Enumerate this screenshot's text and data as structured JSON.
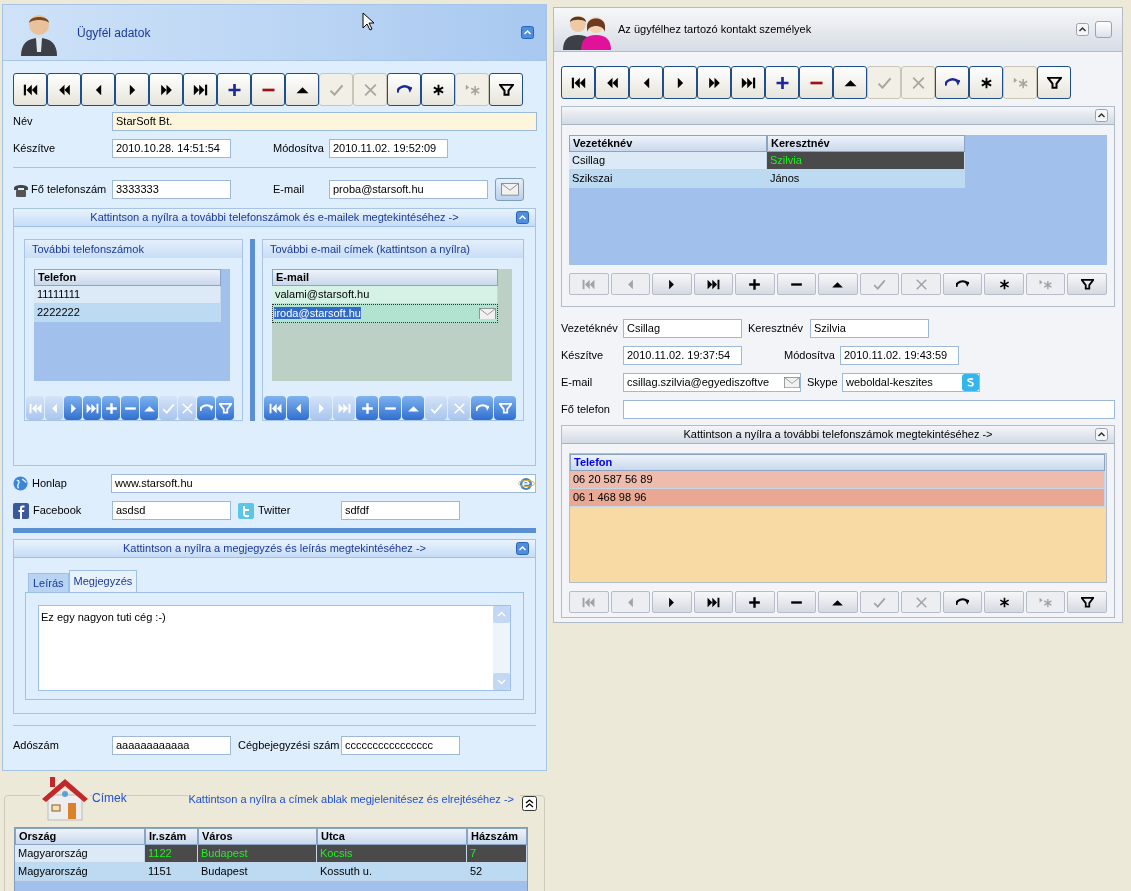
{
  "customer": {
    "title": "Ügyfél adatok",
    "toolbar": [
      {
        "kind": "first",
        "disabled": false
      },
      {
        "kind": "prior_page",
        "disabled": false
      },
      {
        "kind": "prior",
        "disabled": false
      },
      {
        "kind": "next",
        "disabled": false
      },
      {
        "kind": "next_page",
        "disabled": false
      },
      {
        "kind": "last",
        "disabled": false
      },
      {
        "kind": "insert",
        "disabled": false
      },
      {
        "kind": "delete",
        "disabled": false
      },
      {
        "kind": "edit",
        "disabled": false
      },
      {
        "kind": "post",
        "disabled": true
      },
      {
        "kind": "cancel",
        "disabled": true
      },
      {
        "kind": "refresh",
        "disabled": false
      },
      {
        "kind": "apply",
        "disabled": false
      },
      {
        "kind": "cancel_updates",
        "disabled": true
      },
      {
        "kind": "filter",
        "disabled": false
      }
    ],
    "name_label": "Név",
    "name": "StarSoft Bt.",
    "created_label": "Készítve",
    "created": "2010.10.28. 14:51:54",
    "modified_label": "Módosítva",
    "modified": "2010.11.02. 19:52:09",
    "phone_label": "Fő telefonszám",
    "phone": "3333333",
    "email_label": "E-mail",
    "email": "proba@starsoft.hu",
    "contact_section": {
      "title": "Kattintson a nyílra a további telefonszámok és e-mailek megtekintéséhez ->",
      "phones": {
        "title": "További telefonszámok",
        "columns": [
          "Telefon"
        ],
        "rows": [
          {
            "cells": [
              "11111111"
            ],
            "selected": false
          },
          {
            "cells": [
              "2222222"
            ],
            "selected": false
          }
        ],
        "toolbar": [
          {
            "kind": "first",
            "disabled": true
          },
          {
            "kind": "prior",
            "disabled": true
          },
          {
            "kind": "next",
            "disabled": false
          },
          {
            "kind": "last",
            "disabled": false
          },
          {
            "kind": "insert",
            "disabled": false
          },
          {
            "kind": "delete",
            "disabled": false
          },
          {
            "kind": "edit",
            "disabled": false
          },
          {
            "kind": "post",
            "disabled": true
          },
          {
            "kind": "cancel",
            "disabled": true
          },
          {
            "kind": "refresh",
            "disabled": false
          },
          {
            "kind": "filter",
            "disabled": false
          }
        ]
      },
      "emails": {
        "title": "További e-mail címek (kattintson a nyílra)",
        "columns": [
          "E-mail"
        ],
        "rows": [
          {
            "cells": [
              "valami@starsoft.hu"
            ],
            "selected": false
          },
          {
            "cells": [
              "iroda@starsoft.hu"
            ],
            "selected": true
          }
        ],
        "toolbar": [
          {
            "kind": "first",
            "disabled": false
          },
          {
            "kind": "prior",
            "disabled": false
          },
          {
            "kind": "next",
            "disabled": true
          },
          {
            "kind": "last",
            "disabled": true
          },
          {
            "kind": "insert",
            "disabled": false
          },
          {
            "kind": "delete",
            "disabled": false
          },
          {
            "kind": "edit",
            "disabled": false
          },
          {
            "kind": "post",
            "disabled": true
          },
          {
            "kind": "cancel",
            "disabled": true
          },
          {
            "kind": "refresh",
            "disabled": false
          },
          {
            "kind": "filter",
            "disabled": false
          }
        ]
      }
    },
    "homepage_label": "Honlap",
    "homepage": "www.starsoft.hu",
    "facebook_label": "Facebook",
    "facebook": "asdsd",
    "twitter_label": "Twitter",
    "twitter": "sdfdf",
    "notes_section": {
      "title": "Kattintson a nyílra a megjegyzés és leírás megtekintéséhez ->",
      "tabs": [
        {
          "label": "Leírás",
          "selected": false
        },
        {
          "label": "Megjegyzés",
          "selected": true
        }
      ],
      "text": "Ez egy nagyon tuti cég :-)"
    },
    "tax_label": "Adószám",
    "tax": "aaaaaaaaaaaa",
    "registry_label": "Cégbejegyzési szám",
    "registry": "cccccccccccccccc"
  },
  "addresses": {
    "title": "Címek",
    "hint": "Kattintson a nyílra a címek ablak megjelenitésez és elrejtéséhez ->",
    "columns": [
      "Ország",
      "Ir.szám",
      "Város",
      "Utca",
      "Házszám"
    ],
    "rows": [
      {
        "cells": [
          "Magyarország",
          "1122",
          "Budapest",
          "Kocsis",
          "7"
        ],
        "selected": true
      },
      {
        "cells": [
          "Magyarország",
          "1151",
          "Budapest",
          "Kossuth u.",
          "52"
        ],
        "selected": false
      }
    ]
  },
  "contacts": {
    "title": "Az ügyfélhez tartozó kontakt személyek",
    "toolbar": [
      {
        "kind": "first",
        "disabled": false
      },
      {
        "kind": "prior_page",
        "disabled": false
      },
      {
        "kind": "prior",
        "disabled": false
      },
      {
        "kind": "next",
        "disabled": false
      },
      {
        "kind": "next_page",
        "disabled": false
      },
      {
        "kind": "last",
        "disabled": false
      },
      {
        "kind": "insert",
        "disabled": false
      },
      {
        "kind": "delete",
        "disabled": false
      },
      {
        "kind": "edit",
        "disabled": false
      },
      {
        "kind": "post",
        "disabled": true
      },
      {
        "kind": "cancel",
        "disabled": true
      },
      {
        "kind": "refresh",
        "disabled": false
      },
      {
        "kind": "apply",
        "disabled": false
      },
      {
        "kind": "cancel_updates",
        "disabled": true
      },
      {
        "kind": "filter",
        "disabled": false
      }
    ],
    "columns": [
      "Vezetéknév",
      "Keresztnév"
    ],
    "rows": [
      {
        "cells": [
          "Csillag",
          "Szilvia"
        ],
        "selected": true
      },
      {
        "cells": [
          "Szikszai",
          "János"
        ],
        "selected": false
      }
    ],
    "grid_toolbar": [
      {
        "kind": "first",
        "disabled": true
      },
      {
        "kind": "prior",
        "disabled": true
      },
      {
        "kind": "next",
        "disabled": false
      },
      {
        "kind": "last",
        "disabled": false
      },
      {
        "kind": "insert",
        "disabled": false
      },
      {
        "kind": "delete",
        "disabled": false
      },
      {
        "kind": "edit",
        "disabled": false
      },
      {
        "kind": "post",
        "disabled": true
      },
      {
        "kind": "cancel",
        "disabled": true
      },
      {
        "kind": "refresh",
        "disabled": false
      },
      {
        "kind": "apply",
        "disabled": false
      },
      {
        "kind": "cancel_updates",
        "disabled": true
      },
      {
        "kind": "filter",
        "disabled": false
      }
    ],
    "last_name_label": "Vezetéknév",
    "last_name": "Csillag",
    "first_name_label": "Keresztnév",
    "first_name": "Szilvia",
    "created_label": "Készítve",
    "created": "2010.11.02. 19:37:54",
    "modified_label": "Módosítva",
    "modified": "2010.11.02. 19:43:59",
    "email_label": "E-mail",
    "email": "csillag.szilvia@egyediszoftve",
    "skype_label": "Skype",
    "skype": "weboldal-keszites",
    "main_phone_label": "Fő telefon",
    "phones": {
      "title": "Kattintson a nyílra a további telefonszámok megtekintéséhez ->",
      "columns": [
        "Telefon"
      ],
      "rows": [
        {
          "cells": [
            "06 20 587 56 89"
          ],
          "selected": false
        },
        {
          "cells": [
            "06 1 468 98 96"
          ],
          "selected": false
        }
      ],
      "toolbar": [
        {
          "kind": "first",
          "disabled": true
        },
        {
          "kind": "prior",
          "disabled": true
        },
        {
          "kind": "next",
          "disabled": false
        },
        {
          "kind": "last",
          "disabled": false
        },
        {
          "kind": "insert",
          "disabled": false
        },
        {
          "kind": "delete",
          "disabled": false
        },
        {
          "kind": "edit",
          "disabled": false
        },
        {
          "kind": "post",
          "disabled": true
        },
        {
          "kind": "cancel",
          "disabled": true
        },
        {
          "kind": "refresh",
          "disabled": false
        },
        {
          "kind": "apply",
          "disabled": false
        },
        {
          "kind": "cancel_updates",
          "disabled": true
        },
        {
          "kind": "filter",
          "disabled": false
        }
      ]
    }
  }
}
